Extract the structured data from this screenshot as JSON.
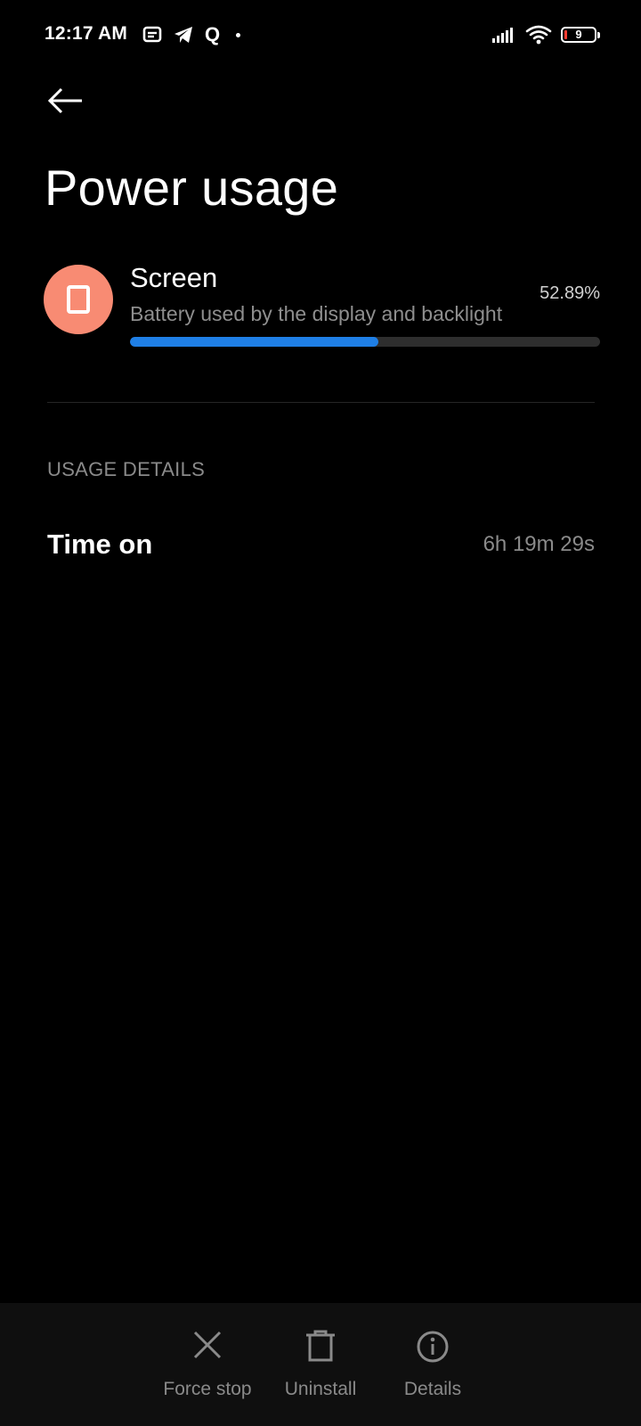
{
  "status_bar": {
    "time": "12:17 AM",
    "left_icons": [
      "notification-icon",
      "telegram-icon",
      "q-app-icon",
      "dot-icon"
    ],
    "q_glyph": "Q",
    "right_icons": [
      "signal-icon",
      "wifi-icon",
      "battery-icon"
    ],
    "battery_level": "9",
    "battery_fraction": 0.09
  },
  "header": {
    "back_icon": "back-arrow-icon",
    "title": "Power usage"
  },
  "app_item": {
    "icon": "screen-icon",
    "icon_bg": "#f88b73",
    "title": "Screen",
    "subtitle": "Battery used by the display and backlight",
    "percent_label": "52.89%",
    "usage_fraction": 0.5289,
    "bar_color": "#1f7fe6"
  },
  "usage_details": {
    "section_title": "USAGE DETAILS",
    "rows": [
      {
        "label": "Time on",
        "value": "6h 19m 29s"
      }
    ]
  },
  "bottom_actions": [
    {
      "icon": "close-icon",
      "label": "Force stop"
    },
    {
      "icon": "trash-icon",
      "label": "Uninstall"
    },
    {
      "icon": "info-icon",
      "label": "Details"
    }
  ]
}
